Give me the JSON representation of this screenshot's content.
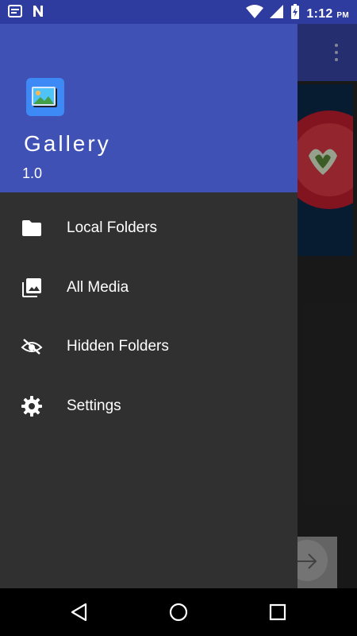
{
  "status_bar": {
    "time": "1:12",
    "ampm": "PM",
    "icons": [
      "notification-icon",
      "n-icon",
      "wifi-icon",
      "signal-icon",
      "battery-charging-icon"
    ]
  },
  "drawer": {
    "app_title": "Gallery",
    "app_version": "1.0",
    "items": [
      {
        "label": "Local Folders",
        "icon": "folder-icon"
      },
      {
        "label": "All Media",
        "icon": "photo-library-icon"
      },
      {
        "label": "Hidden Folders",
        "icon": "hidden-eye-icon"
      },
      {
        "label": "Settings",
        "icon": "gear-icon"
      }
    ]
  },
  "colors": {
    "header": "#3f51b5",
    "status_bar": "#2f3c9f",
    "drawer_bg": "#303030"
  },
  "nav_bar": {
    "buttons": [
      "back-icon",
      "home-icon",
      "recents-icon"
    ]
  }
}
